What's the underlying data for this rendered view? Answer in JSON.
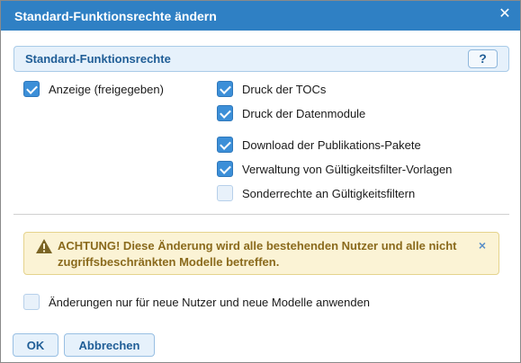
{
  "dialog": {
    "title": "Standard-Funktionsrechte ändern",
    "close_icon": "close-icon"
  },
  "section": {
    "title": "Standard-Funktionsrechte",
    "help_label": "?"
  },
  "rights_left": [
    {
      "label": "Anzeige (freigegeben)",
      "checked": true
    }
  ],
  "rights_right": [
    {
      "label": "Druck der TOCs",
      "checked": true
    },
    {
      "label": "Druck der Datenmodule",
      "checked": true
    },
    {
      "label": "Download der Publikations-Pakete",
      "checked": true
    },
    {
      "label": "Verwaltung von Gültigkeitsfilter-Vorlagen",
      "checked": true
    },
    {
      "label": "Sonderrechte an Gültigkeitsfiltern",
      "checked": false
    }
  ],
  "warning": {
    "icon": "warning-triangle-icon",
    "text": "ACHTUNG! Diese Änderung wird alle bestehenden Nutzer und alle nicht zugriffsbeschränkten Modelle betreffen.",
    "dismiss_label": "×"
  },
  "apply_option": {
    "label": "Änderungen nur für neue Nutzer und neue Modelle anwenden",
    "checked": false
  },
  "buttons": {
    "ok_label": "OK",
    "cancel_label": "Abbrechen"
  },
  "colors": {
    "titlebar": "#2f80c4",
    "accent": "#3c8fd8",
    "warning_bg": "#fbf3d5",
    "warning_text": "#8a6a1c"
  }
}
